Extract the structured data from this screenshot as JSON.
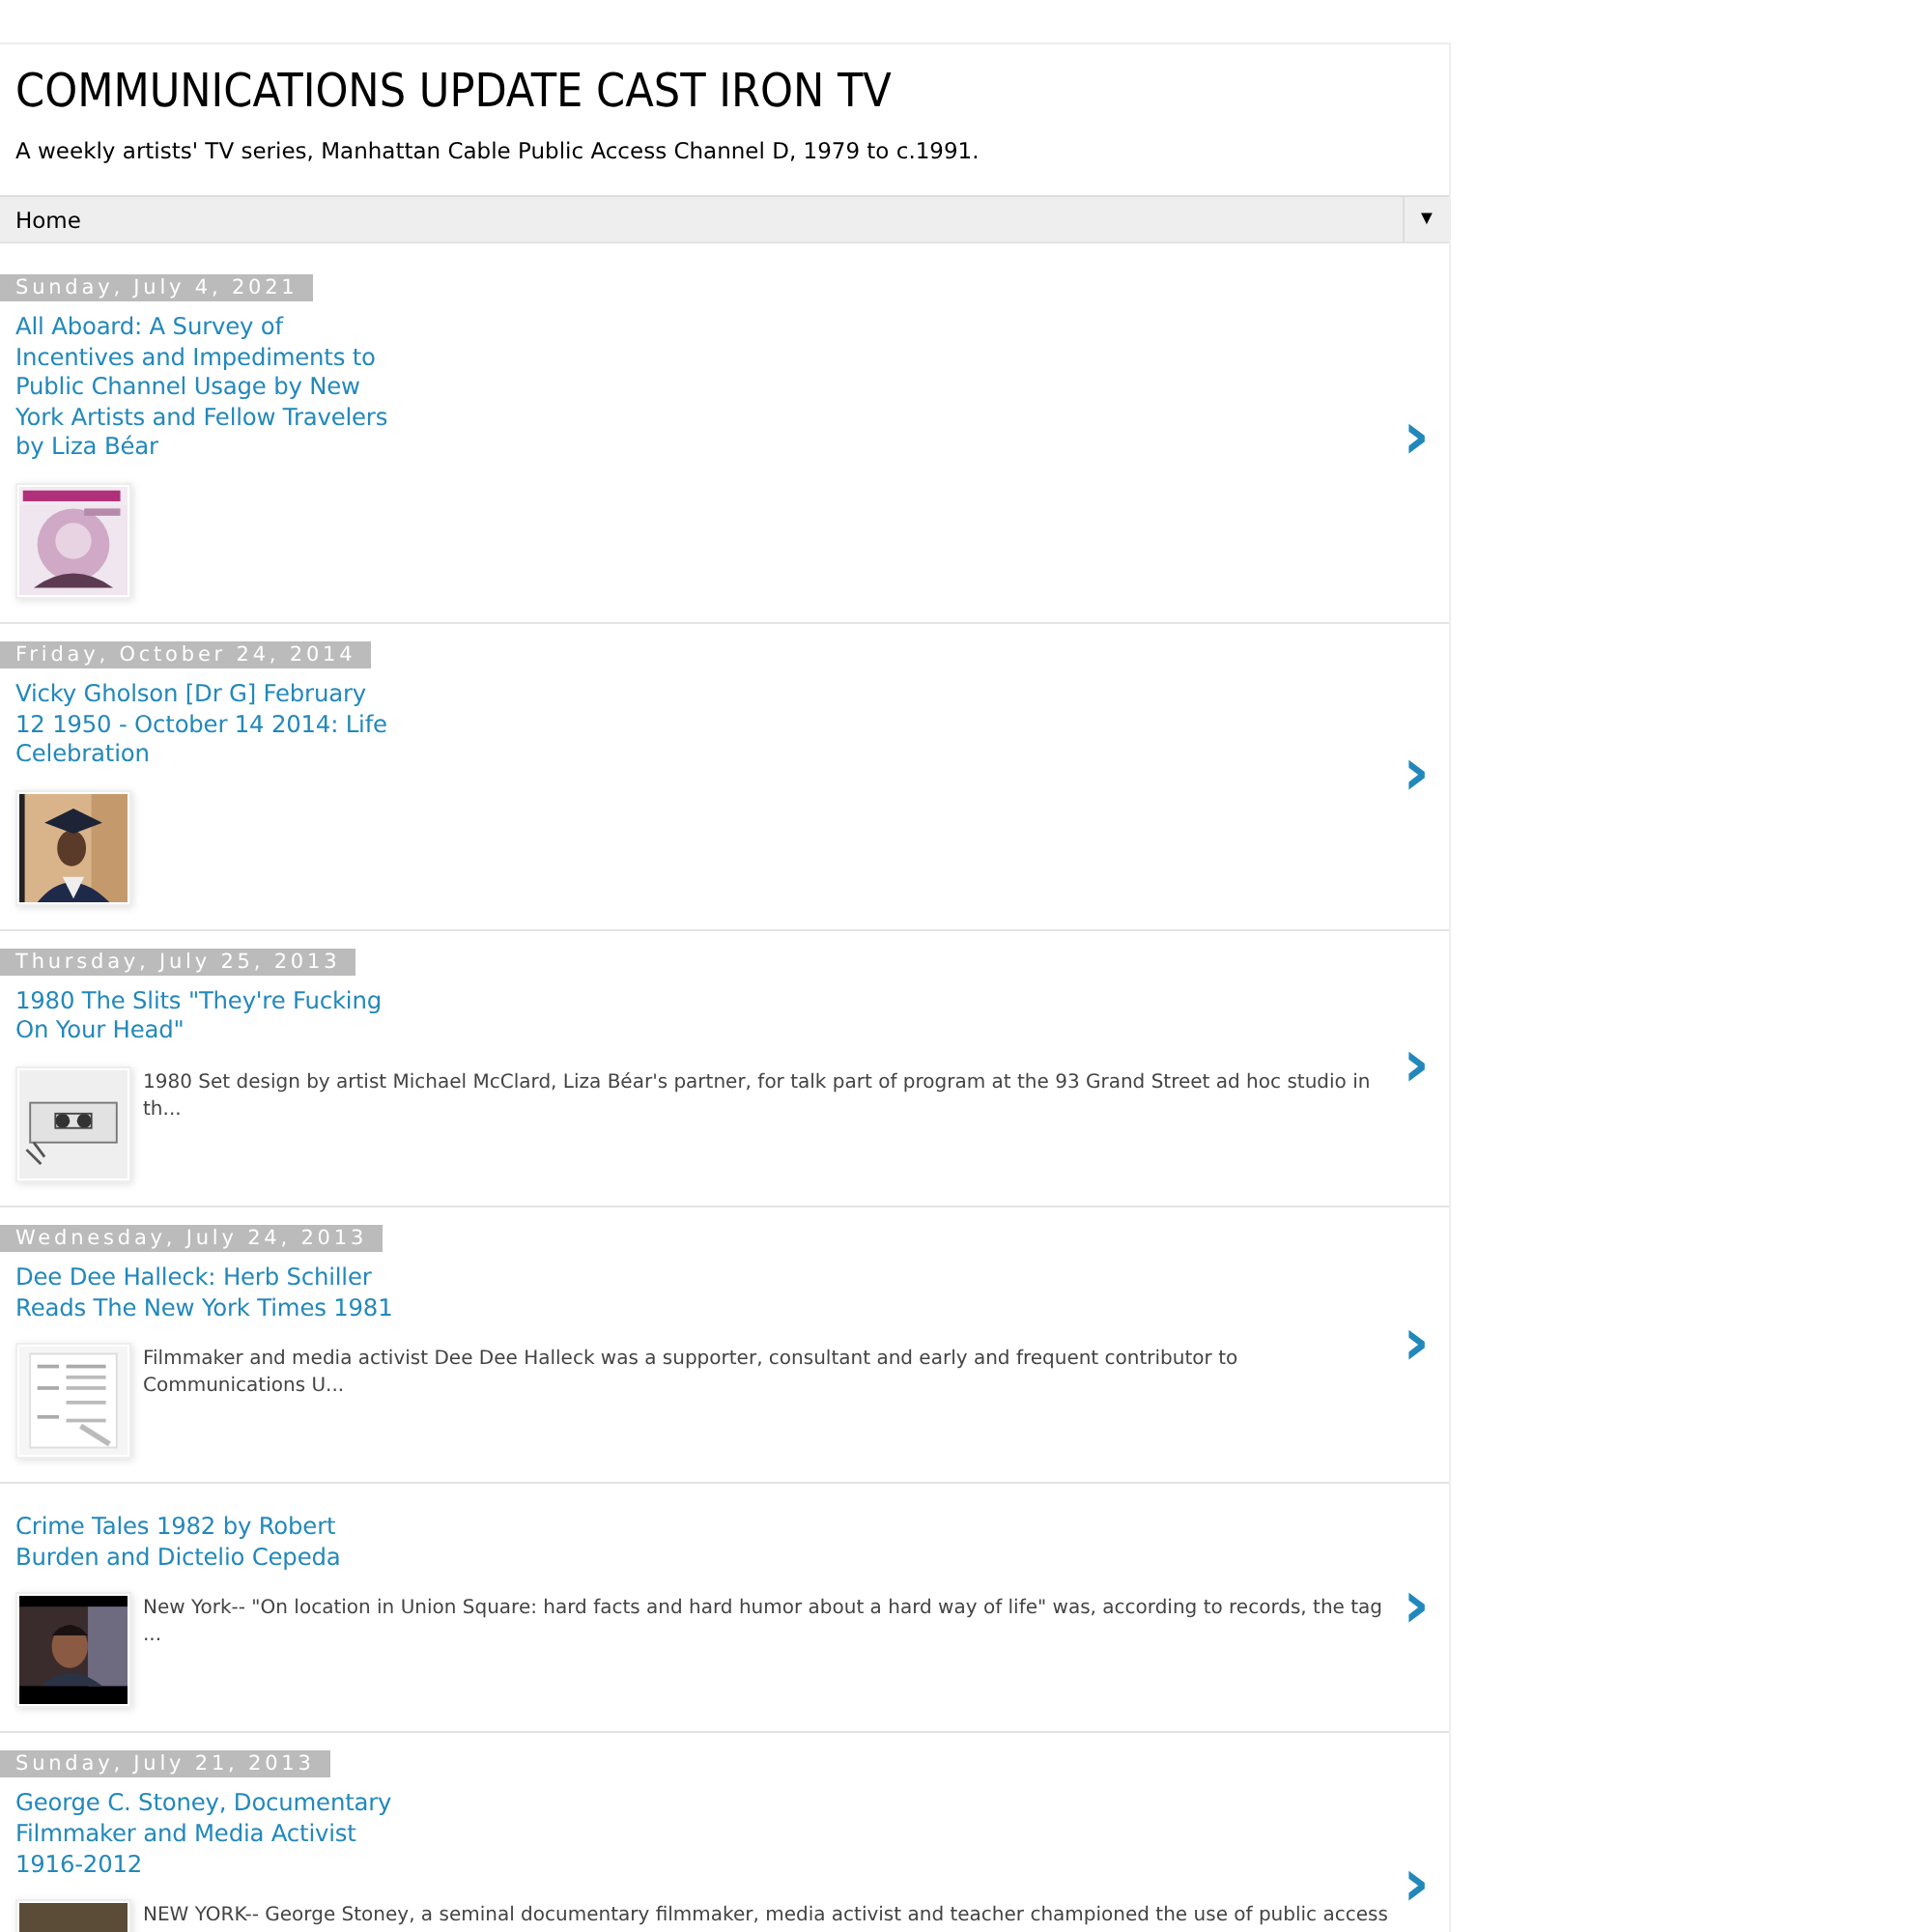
{
  "header": {
    "title": "COMMUNICATIONS UPDATE CAST IRON TV",
    "description": "A weekly artists' TV series, Manhattan Cable Public Access Channel D, 1979 to c.1991."
  },
  "nav": {
    "label": "Home",
    "dropdown": "▼"
  },
  "posts": [
    {
      "date": "Sunday, July 4, 2021",
      "title": "All Aboard: A Survey of Incentives and Impediments to Public Channel Usage by New York Artists and Fellow Travelers by Liza Béar",
      "arrow": "›"
    },
    {
      "date": "Friday, October 24, 2014",
      "title": "Vicky Gholson [Dr G] February 12 1950 - October 14 2014: Life Celebration",
      "arrow": "›"
    },
    {
      "date": "Thursday, July 25, 2013",
      "title": "1980 The Slits \"They're Fucking On Your Head\"",
      "snippet": "1980 Set design by artist Michael McClard, Liza Béar's partner,  for talk part of program at the 93 Grand Street ad hoc studio in th...",
      "arrow": "›"
    },
    {
      "date": "Wednesday, July 24, 2013",
      "title": "Dee Dee Halleck: Herb Schiller Reads The New York Times 1981",
      "snippet": "Filmmaker and media activist  Dee Dee Halleck was a supporter, consultant and early and frequent contributor to Communications U...",
      "arrow": "›"
    },
    {
      "title": "Crime Tales 1982 by Robert Burden and Dictelio Cepeda",
      "snippet": "New York-- \"On location in Union Square: hard facts and hard humor about a hard way of life\" was, according to records, the tag ...",
      "arrow": "›"
    },
    {
      "date": "Sunday, July 21, 2013",
      "title": "George C. Stoney, Documentary Filmmaker and Media Activist 1916-2012",
      "snippet": "NEW YORK-- George Stoney, a seminal documentary filmmaker, media activist and teacher championed the use of public access",
      "arrow": "›"
    }
  ]
}
